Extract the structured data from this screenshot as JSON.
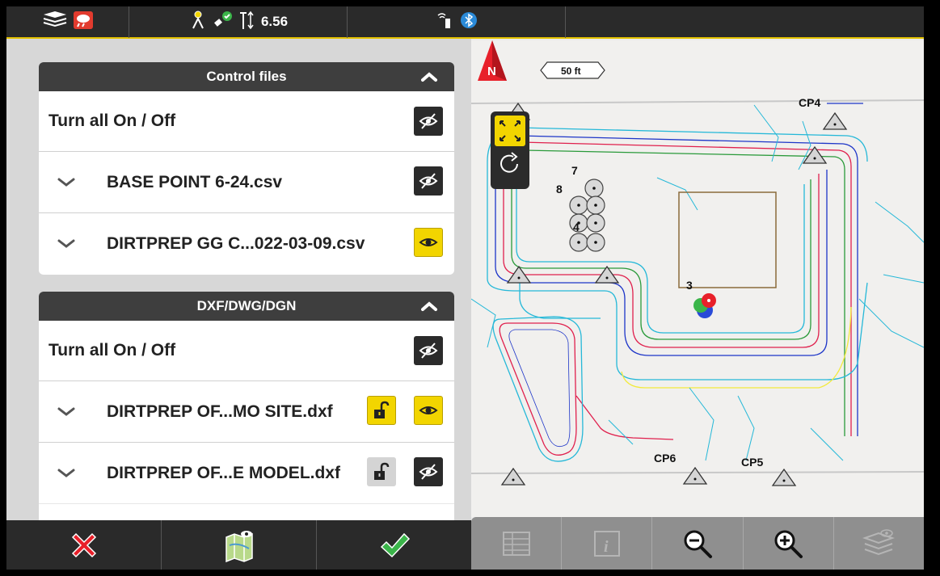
{
  "status_bar": {
    "precision_value": "6.56",
    "icons": [
      "layers-app-icon",
      "weather-alert-icon",
      "surveyor-icon",
      "satellite-ok-icon",
      "antenna-height-icon",
      "radio-link-icon",
      "bluetooth-icon"
    ]
  },
  "control_files": {
    "header": "Control files",
    "toggle_all_label": "Turn all On / Off",
    "files": [
      {
        "name": "BASE POINT 6-24.csv",
        "visible": false
      },
      {
        "name": "DIRTPREP GG C...022-03-09.csv",
        "visible": true
      }
    ]
  },
  "dxf": {
    "header": "DXF/DWG/DGN",
    "toggle_all_label": "Turn all On / Off",
    "files": [
      {
        "name": "DIRTPREP OF...MO SITE.dxf",
        "visible": true,
        "locked": false,
        "lock_active": true
      },
      {
        "name": "DIRTPREP OF...E MODEL.dxf",
        "visible": false,
        "locked": false,
        "lock_active": false
      }
    ]
  },
  "map": {
    "scale_label": "50 ft",
    "north_label": "N",
    "point_labels": {
      "cp4": "CP4",
      "cp5": "CP5",
      "cp6": "CP6",
      "p7": "7",
      "p8": "8",
      "p4": "4",
      "p3": "3"
    }
  },
  "bottom_left": [
    "cancel-icon",
    "map-view-icon",
    "confirm-icon"
  ],
  "bottom_right": [
    "table-icon",
    "info-icon",
    "zoom-out-icon",
    "zoom-in-icon",
    "layers-icon"
  ],
  "colors": {
    "accent_yellow": "#f2d500",
    "dark": "#2a2a2a",
    "cancel_red": "#e8202a",
    "confirm_green": "#3bb54a"
  }
}
